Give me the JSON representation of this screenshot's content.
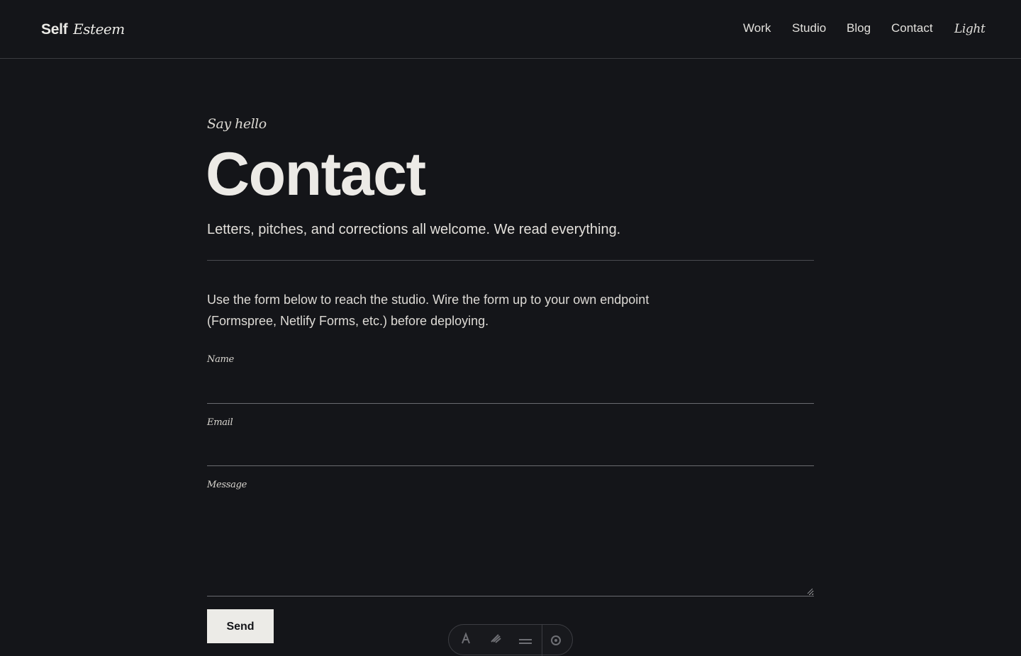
{
  "header": {
    "brand_bold": "Self",
    "brand_italic": "Esteem",
    "nav": {
      "work": "Work",
      "studio": "Studio",
      "blog": "Blog",
      "contact": "Contact",
      "theme_toggle": "Light"
    }
  },
  "hero": {
    "eyebrow": "Say hello",
    "title": "Contact",
    "lede": "Letters, pitches, and corrections all welcome. We read everything."
  },
  "intro": "Use the form below to reach the studio. Wire the form up to your own endpoint (Formspree, Netlify Forms, etc.) before deploying.",
  "form": {
    "name_label": "Name",
    "name_value": "",
    "email_label": "Email",
    "email_value": "",
    "message_label": "Message",
    "message_value": "",
    "submit_label": "Send"
  },
  "dock": {
    "icons": [
      "pen-icon",
      "brush-icon",
      "menu-icon",
      "settings-icon"
    ]
  },
  "colors": {
    "background": "#141519",
    "text": "#e9e6e1",
    "rule": "#4a4b50",
    "button_bg": "#ecebe7"
  }
}
